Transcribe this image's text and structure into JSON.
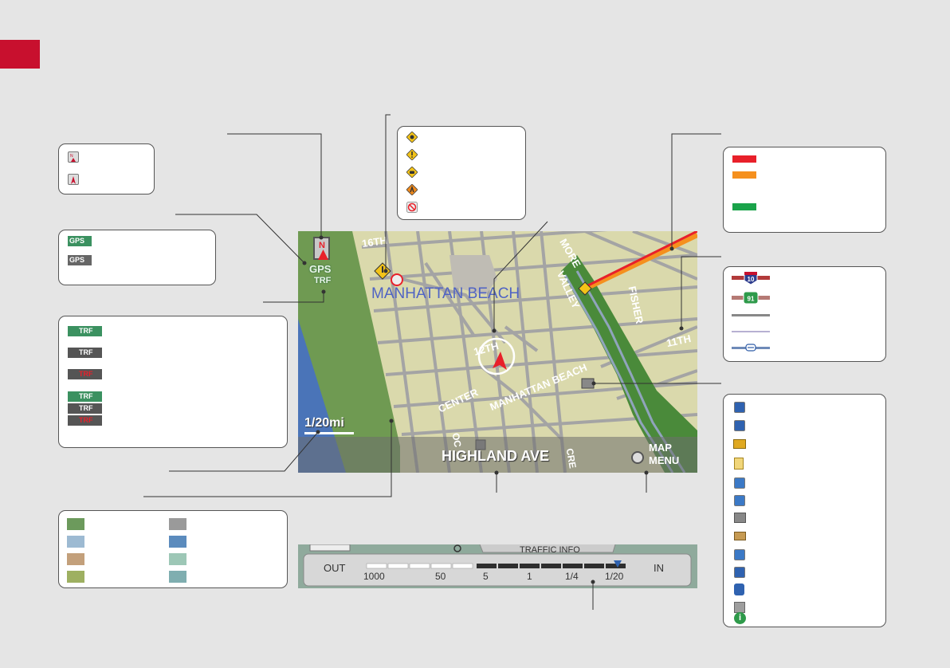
{
  "map": {
    "heading_indicator": "N",
    "gps_label": "GPS",
    "traffic_label": "TRF",
    "city_name": "MANHATTAN BEACH",
    "scale": "1/20mi",
    "current_street": "HIGHLAND AVE",
    "menu_button": {
      "line1": "MAP",
      "line2": "MENU"
    },
    "street_labels": [
      "16TH",
      "MORE",
      "VALLEY",
      "FISHER",
      "11TH",
      "12TH",
      "CENTER",
      "MANHATTAN BEACH",
      "OC",
      "CRE"
    ],
    "interstate_number": "10",
    "state_route_number": "91"
  },
  "traffic_bar": {
    "title": "TRAFFIC INFO",
    "out_label": "OUT",
    "in_label": "IN",
    "scale_labels": [
      "1000",
      "50",
      "5",
      "1",
      "1/4",
      "1/20"
    ]
  },
  "colors": {
    "page_bg": "#e5e5e5",
    "brand_red": "#c8102e",
    "traffic_red": "#e8202a",
    "traffic_orange": "#f5901e",
    "traffic_green": "#1aa34a",
    "map_land": "#dad9ac",
    "map_park": "#6f9a52",
    "map_water": "#4a74b8",
    "map_road": "#a4a4a4"
  },
  "area_swatches": [
    "#6c9a5c",
    "#9dbad2",
    "#c3a07b",
    "#9eb061",
    "#9a9a9a",
    "#5b8bbd",
    "#9dc7b6",
    "#7faeb0"
  ]
}
